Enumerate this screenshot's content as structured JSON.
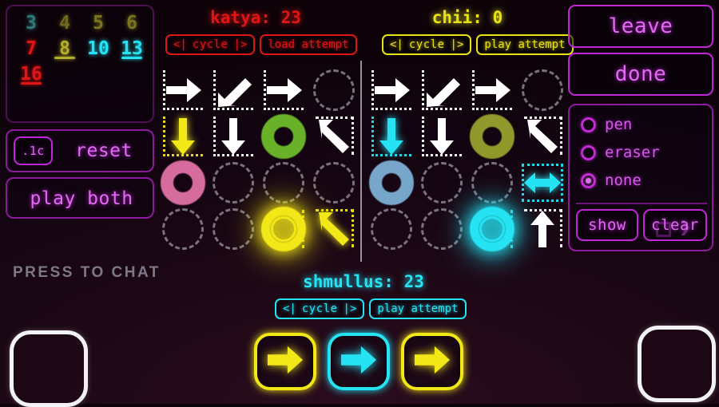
{
  "numbers": {
    "cells": [
      {
        "value": "3",
        "color": "#2f7a78",
        "underline": ""
      },
      {
        "value": "4",
        "color": "#6e6a22",
        "underline": ""
      },
      {
        "value": "5",
        "color": "#7b7520",
        "underline": ""
      },
      {
        "value": "6",
        "color": "#7b7520",
        "underline": ""
      },
      {
        "value": "7",
        "color": "#e01515",
        "underline": ""
      },
      {
        "value": "8",
        "color": "#b5ae2c",
        "underline": "#b5ae2c"
      },
      {
        "value": "10",
        "color": "#25e3f2",
        "underline": ""
      },
      {
        "value": "13",
        "color": "#25e3f2",
        "underline": "#25e3f2"
      },
      {
        "value": "16",
        "color": "#e01515",
        "underline": "#e01515"
      }
    ]
  },
  "left_controls": {
    "speed_label": ".1c",
    "reset_label": "reset",
    "play_both_label": "play both"
  },
  "chat": {
    "prompt": "PRESS TO CHAT"
  },
  "right_controls": {
    "leave_label": "leave",
    "done_label": "done",
    "tools": [
      {
        "label": "pen",
        "selected": false
      },
      {
        "label": "eraser",
        "selected": false
      },
      {
        "label": "none",
        "selected": true
      }
    ],
    "pen_square_icon": "square-icon",
    "pen_chevron_icon": "chevron-right-icon",
    "show_label": "show",
    "clear_label": "clear"
  },
  "players": [
    {
      "key": "katya",
      "name_score": "katya: 23",
      "color": "#e01515",
      "cycle_prev": "<|",
      "cycle_label": "cycle",
      "cycle_next": "|>",
      "action_label": "load attempt"
    },
    {
      "key": "chii",
      "name_score": "chii: 0",
      "color": "#e8e317",
      "cycle_prev": "<|",
      "cycle_label": "cycle",
      "cycle_next": "|>",
      "action_label": "play attempt"
    },
    {
      "key": "shmullus",
      "name_score": "shmullus: 23",
      "color": "#25e3f2",
      "cycle_prev": "<|",
      "cycle_label": "cycle",
      "cycle_next": "|>",
      "action_label": "play attempt"
    }
  ],
  "grids": {
    "left": {
      "owner": "katya",
      "cells": [
        {
          "kind": "arrow",
          "dir": "right",
          "color": "#ffffff",
          "frame": "L",
          "frame_color": "#ffffff"
        },
        {
          "kind": "arrow",
          "dir": "down-left",
          "color": "#ffffff",
          "frame": "L",
          "frame_color": "#ffffff"
        },
        {
          "kind": "arrow",
          "dir": "right",
          "color": "#ffffff",
          "frame": "L",
          "frame_color": "#ffffff"
        },
        {
          "kind": "empty"
        },
        {
          "kind": "arrow",
          "dir": "down",
          "color": "#f2e717",
          "frame": "L",
          "frame_color": "#f2e717"
        },
        {
          "kind": "arrow",
          "dir": "down",
          "color": "#ffffff",
          "frame": "L",
          "frame_color": "#ffffff"
        },
        {
          "kind": "ring",
          "color": "#6fbf2a",
          "glow": false
        },
        {
          "kind": "arrow",
          "dir": "up-left",
          "color": "#ffffff",
          "frame": "T",
          "frame_color": "#ffffff"
        },
        {
          "kind": "ring",
          "color": "#e574a8",
          "glow": false
        },
        {
          "kind": "empty"
        },
        {
          "kind": "empty"
        },
        {
          "kind": "empty"
        },
        {
          "kind": "empty"
        },
        {
          "kind": "empty"
        },
        {
          "kind": "ring",
          "color": "#f2e717",
          "glow": true
        },
        {
          "kind": "arrow",
          "dir": "up-left",
          "color": "#f2e717",
          "frame": "T",
          "frame_color": "#f2e717"
        }
      ]
    },
    "right": {
      "owner": "chii",
      "cells": [
        {
          "kind": "arrow",
          "dir": "right",
          "color": "#ffffff",
          "frame": "L",
          "frame_color": "#ffffff"
        },
        {
          "kind": "arrow",
          "dir": "down-left",
          "color": "#ffffff",
          "frame": "L",
          "frame_color": "#ffffff"
        },
        {
          "kind": "arrow",
          "dir": "right",
          "color": "#ffffff",
          "frame": "L",
          "frame_color": "#ffffff"
        },
        {
          "kind": "empty"
        },
        {
          "kind": "arrow",
          "dir": "down",
          "color": "#25e3f2",
          "frame": "L",
          "frame_color": "#25e3f2"
        },
        {
          "kind": "arrow",
          "dir": "down",
          "color": "#ffffff",
          "frame": "L",
          "frame_color": "#ffffff"
        },
        {
          "kind": "ring",
          "color": "#9aa52e",
          "glow": false
        },
        {
          "kind": "arrow",
          "dir": "up-left",
          "color": "#ffffff",
          "frame": "T",
          "frame_color": "#ffffff"
        },
        {
          "kind": "ring",
          "color": "#7fb3d9",
          "glow": false
        },
        {
          "kind": "empty"
        },
        {
          "kind": "empty"
        },
        {
          "kind": "arrow",
          "dir": "left-right",
          "color": "#25e3f2",
          "frame": "BOX",
          "frame_color": "#25e3f2"
        },
        {
          "kind": "empty"
        },
        {
          "kind": "empty"
        },
        {
          "kind": "ring",
          "color": "#25e3f2",
          "glow": true
        },
        {
          "kind": "arrow",
          "dir": "up",
          "color": "#ffffff",
          "frame": "T",
          "frame_color": "#ffffff"
        }
      ]
    }
  },
  "bottom_actions": [
    {
      "icon": "arrow-right-icon",
      "color": "#f2e717"
    },
    {
      "icon": "arrow-right-icon",
      "color": "#25e3f2"
    },
    {
      "icon": "arrow-right-icon",
      "color": "#f2e717"
    }
  ]
}
